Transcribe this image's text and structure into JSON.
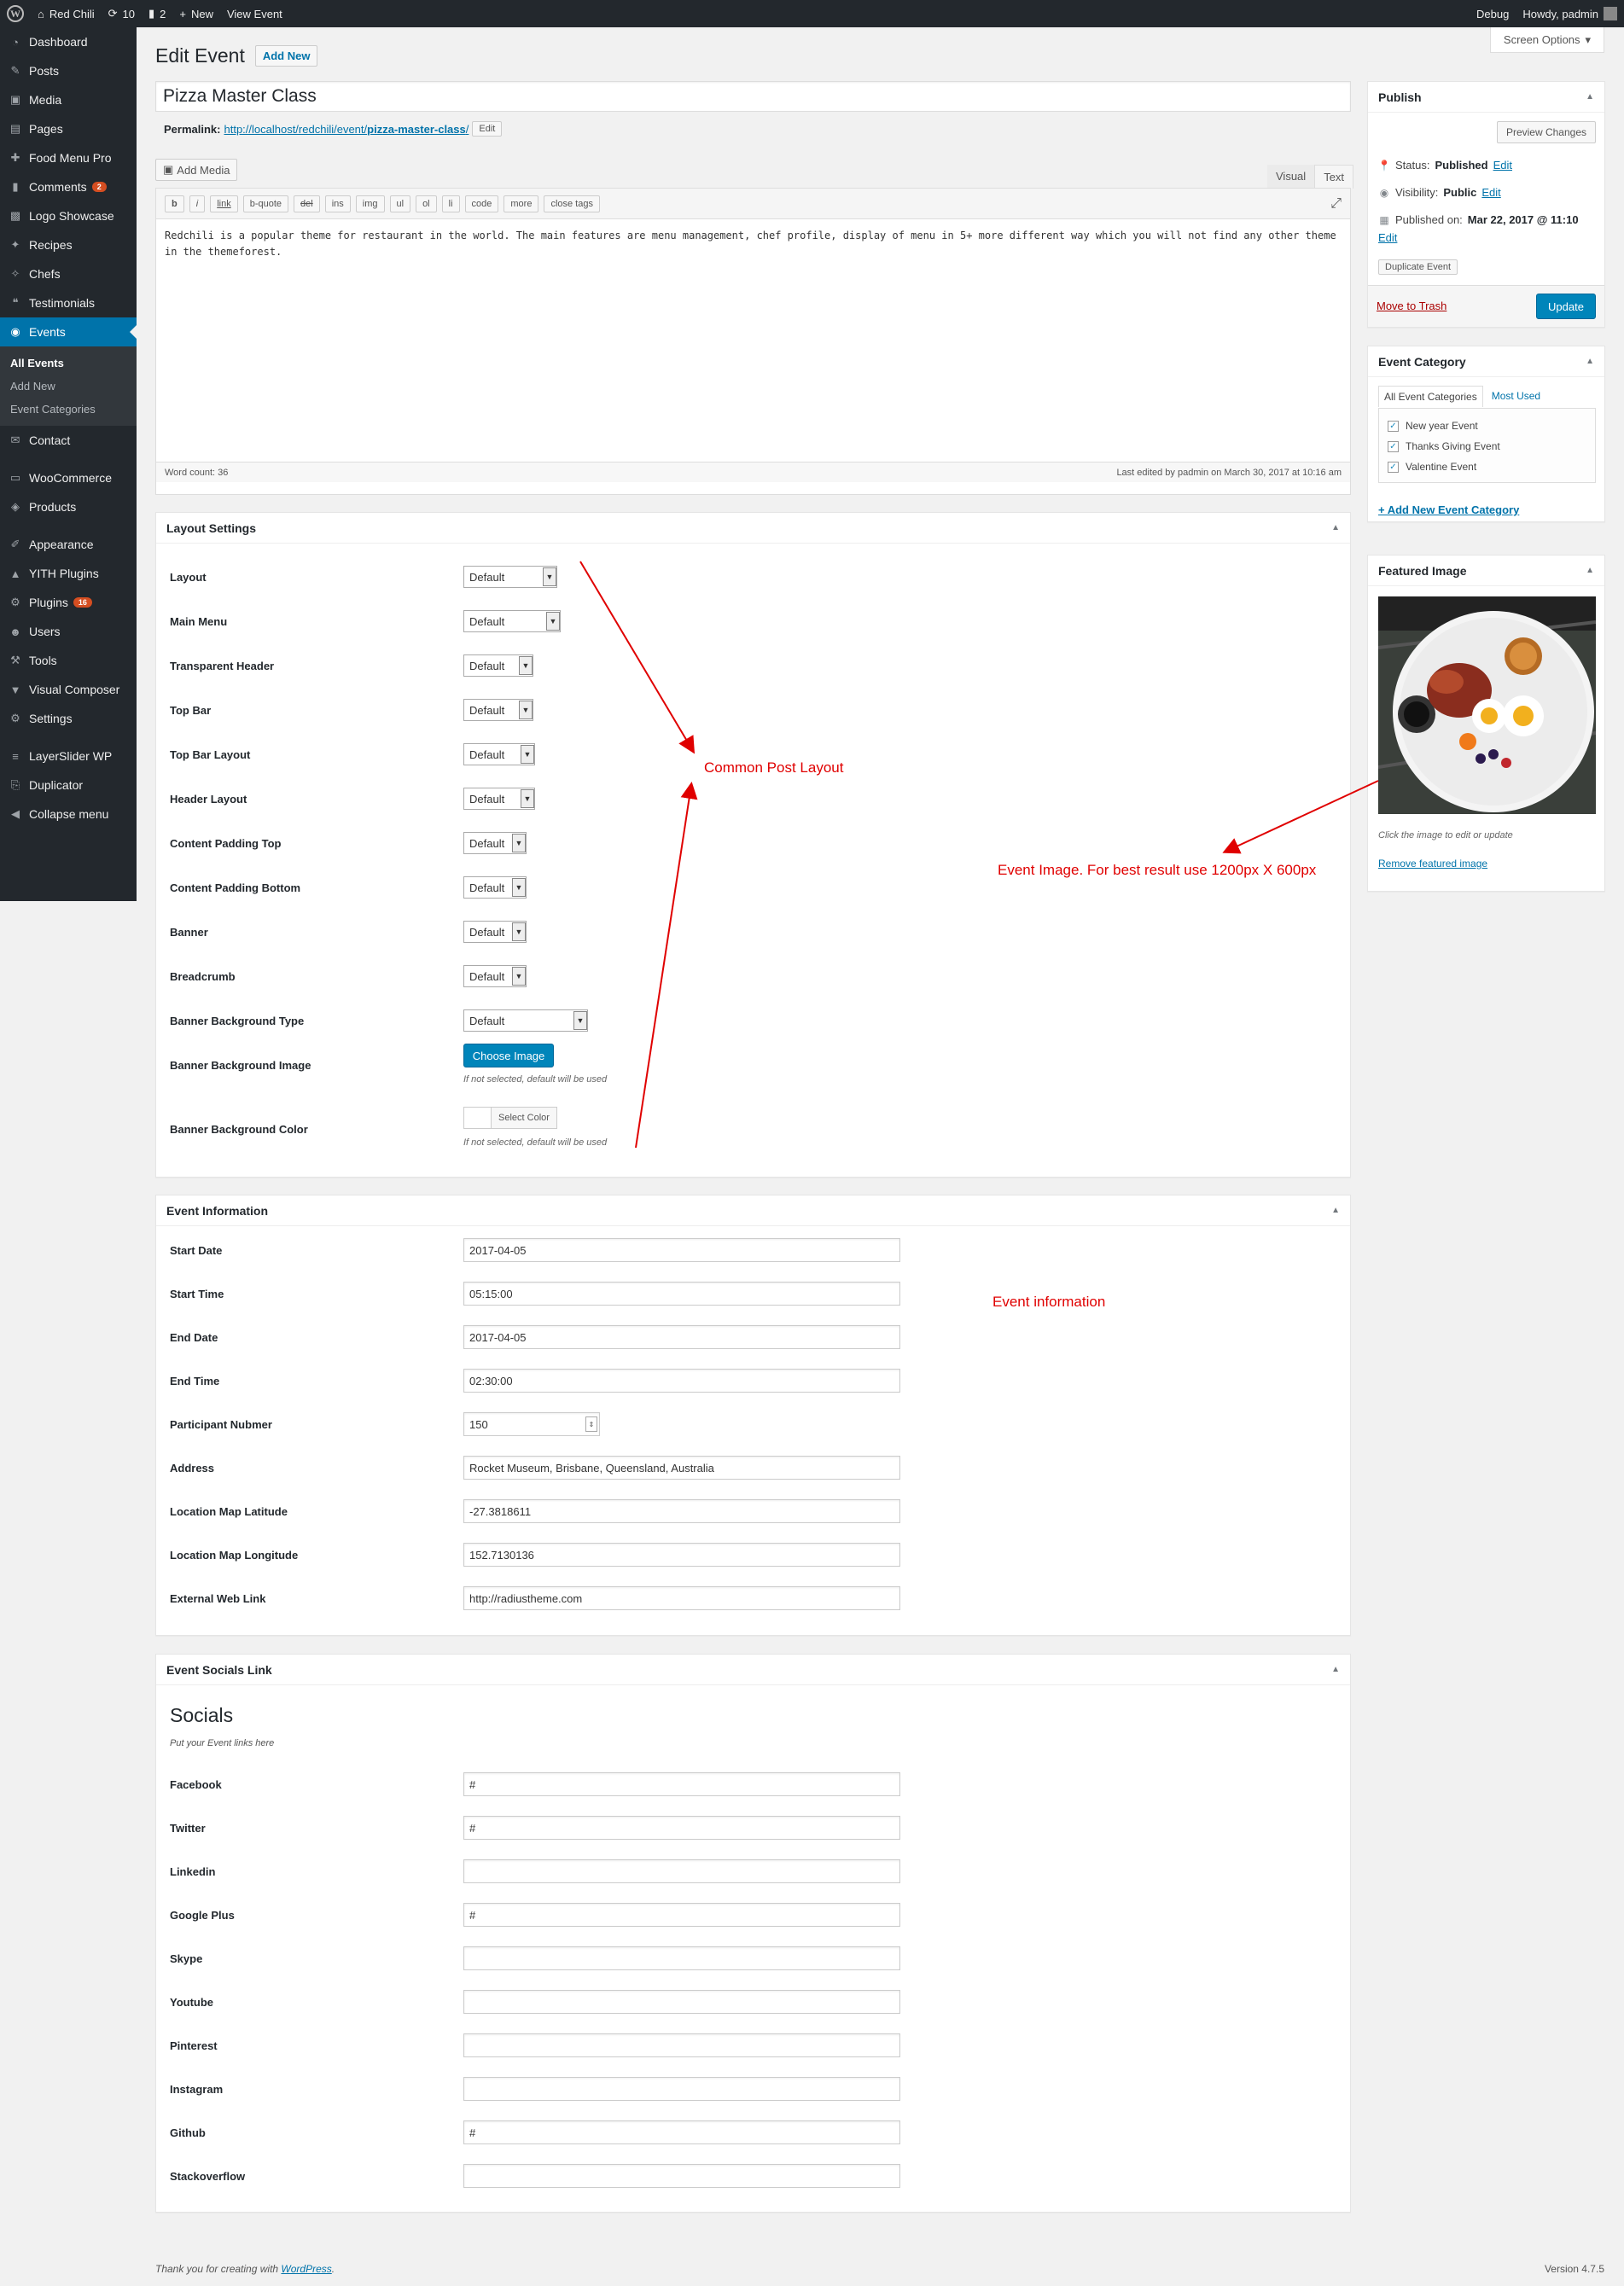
{
  "adminbar": {
    "site_name": "Red Chili",
    "updates": "10",
    "comments": "2",
    "new_label": "New",
    "view_label": "View Event",
    "debug": "Debug",
    "howdy": "Howdy, padmin"
  },
  "sidebar": {
    "items": [
      {
        "label": "Dashboard",
        "icon": "dashboard-icon"
      },
      {
        "label": "Posts",
        "icon": "pin-icon"
      },
      {
        "label": "Media",
        "icon": "media-icon"
      },
      {
        "label": "Pages",
        "icon": "pages-icon"
      },
      {
        "label": "Food Menu Pro",
        "icon": "food-icon"
      },
      {
        "label": "Comments",
        "icon": "comment-icon",
        "badge": "2"
      },
      {
        "label": "Logo Showcase",
        "icon": "logo-icon"
      },
      {
        "label": "Recipes",
        "icon": "recipe-icon"
      },
      {
        "label": "Chefs",
        "icon": "chef-icon"
      },
      {
        "label": "Testimonials",
        "icon": "testimonial-icon"
      },
      {
        "label": "Events",
        "icon": "events-icon"
      }
    ],
    "events_sub": [
      "All Events",
      "Add New",
      "Event Categories"
    ],
    "items2": [
      {
        "label": "Contact",
        "icon": "contact-icon"
      }
    ],
    "items3": [
      {
        "label": "WooCommerce",
        "icon": "woo-icon"
      },
      {
        "label": "Products",
        "icon": "products-icon"
      }
    ],
    "items4": [
      {
        "label": "Appearance",
        "icon": "appearance-icon"
      },
      {
        "label": "YITH Plugins",
        "icon": "yith-icon"
      },
      {
        "label": "Plugins",
        "icon": "plugins-icon",
        "badge": "16"
      },
      {
        "label": "Users",
        "icon": "users-icon"
      },
      {
        "label": "Tools",
        "icon": "tools-icon"
      },
      {
        "label": "Visual Composer",
        "icon": "vc-icon"
      },
      {
        "label": "Settings",
        "icon": "settings-icon"
      }
    ],
    "items5": [
      {
        "label": "LayerSlider WP",
        "icon": "layers-icon"
      },
      {
        "label": "Duplicator",
        "icon": "duplicator-icon"
      },
      {
        "label": "Collapse menu",
        "icon": "collapse-icon"
      }
    ]
  },
  "header": {
    "title": "Edit Event",
    "add_new": "Add New",
    "screen_options": "Screen Options"
  },
  "post": {
    "title": "Pizza Master Class",
    "permalink_label": "Permalink:",
    "permalink_base": "http://localhost/redchili/event/",
    "permalink_slug": "pizza-master-class",
    "permalink_end": "/",
    "permalink_edit": "Edit"
  },
  "editor": {
    "add_media": "Add Media",
    "tab_visual": "Visual",
    "tab_text": "Text",
    "buttons": [
      "b",
      "i",
      "link",
      "b-quote",
      "del",
      "ins",
      "img",
      "ul",
      "ol",
      "li",
      "code",
      "more",
      "close tags"
    ],
    "content": "Redchili is a popular theme for restaurant in the world. The main features are menu management, chef profile, display of menu in 5+ more different way which you will not find any other theme in the themeforest.",
    "word_count": "Word count: 36",
    "last_edited": "Last edited by padmin on March 30, 2017 at 10:16 am"
  },
  "layout_settings": {
    "title": "Layout Settings",
    "fields": [
      {
        "label": "Layout",
        "value": "Default"
      },
      {
        "label": "Main Menu",
        "value": "Default"
      },
      {
        "label": "Transparent Header",
        "value": "Default"
      },
      {
        "label": "Top Bar",
        "value": "Default"
      },
      {
        "label": "Top Bar Layout",
        "value": "Default"
      },
      {
        "label": "Header Layout",
        "value": "Default"
      },
      {
        "label": "Content Padding Top",
        "value": "Default"
      },
      {
        "label": "Content Padding Bottom",
        "value": "Default"
      },
      {
        "label": "Banner",
        "value": "Default"
      },
      {
        "label": "Breadcrumb",
        "value": "Default"
      },
      {
        "label": "Banner Background Type",
        "value": "Default"
      }
    ],
    "bg_image_label": "Banner Background Image",
    "choose_image": "Choose Image",
    "bg_image_hint": "If not selected, default will be used",
    "bg_color_label": "Banner Background Color",
    "select_color": "Select Color",
    "bg_color_hint": "If not selected, default will be used"
  },
  "event_info": {
    "title": "Event Information",
    "fields": [
      {
        "label": "Start Date",
        "value": "2017-04-05"
      },
      {
        "label": "Start Time",
        "value": "05:15:00"
      },
      {
        "label": "End Date",
        "value": "2017-04-05"
      },
      {
        "label": "End Time",
        "value": "02:30:00"
      },
      {
        "label": "Participant Nubmer",
        "value": "150"
      },
      {
        "label": "Address",
        "value": "Rocket Museum, Brisbane, Queensland, Australia"
      },
      {
        "label": "Location Map Latitude",
        "value": "-27.3818611"
      },
      {
        "label": "Location Map Longitude",
        "value": "152.7130136"
      },
      {
        "label": "External Web Link",
        "value": "http://radiustheme.com"
      }
    ]
  },
  "socials": {
    "title": "Event Socials Link",
    "heading": "Socials",
    "subheading": "Put your Event links here",
    "fields": [
      {
        "label": "Facebook",
        "value": "#"
      },
      {
        "label": "Twitter",
        "value": "#"
      },
      {
        "label": "Linkedin",
        "value": ""
      },
      {
        "label": "Google Plus",
        "value": "#"
      },
      {
        "label": "Skype",
        "value": ""
      },
      {
        "label": "Youtube",
        "value": ""
      },
      {
        "label": "Pinterest",
        "value": ""
      },
      {
        "label": "Instagram",
        "value": ""
      },
      {
        "label": "Github",
        "value": "#"
      },
      {
        "label": "Stackoverflow",
        "value": ""
      }
    ]
  },
  "publish": {
    "title": "Publish",
    "preview": "Preview Changes",
    "status_label": "Status:",
    "status_value": "Published",
    "visibility_label": "Visibility:",
    "visibility_value": "Public",
    "published_label": "Published on:",
    "published_value": "Mar 22, 2017 @ 11:10",
    "edit": "Edit",
    "duplicate": "Duplicate Event",
    "trash": "Move to Trash",
    "update": "Update"
  },
  "category": {
    "title": "Event Category",
    "tab_all": "All Event Categories",
    "tab_used": "Most Used",
    "items": [
      "New year Event",
      "Thanks Giving Event",
      "Valentine Event"
    ],
    "add_new": "+ Add New Event Category"
  },
  "featured": {
    "title": "Featured Image",
    "hint": "Click the image to edit or update",
    "remove": "Remove featured image"
  },
  "annotations": {
    "common_layout": "Common Post Layout",
    "event_image": "Event Image. For best result use 1200px X 600px",
    "event_info": "Event information"
  },
  "footer": {
    "thanks": "Thank you for creating with",
    "wp": "WordPress",
    "version": "Version 4.7.5"
  },
  "colors": {
    "accent": "#0073aa",
    "primary_button": "#0085ba",
    "annotation": "#e00000",
    "sidebar_bg": "#23282d"
  }
}
